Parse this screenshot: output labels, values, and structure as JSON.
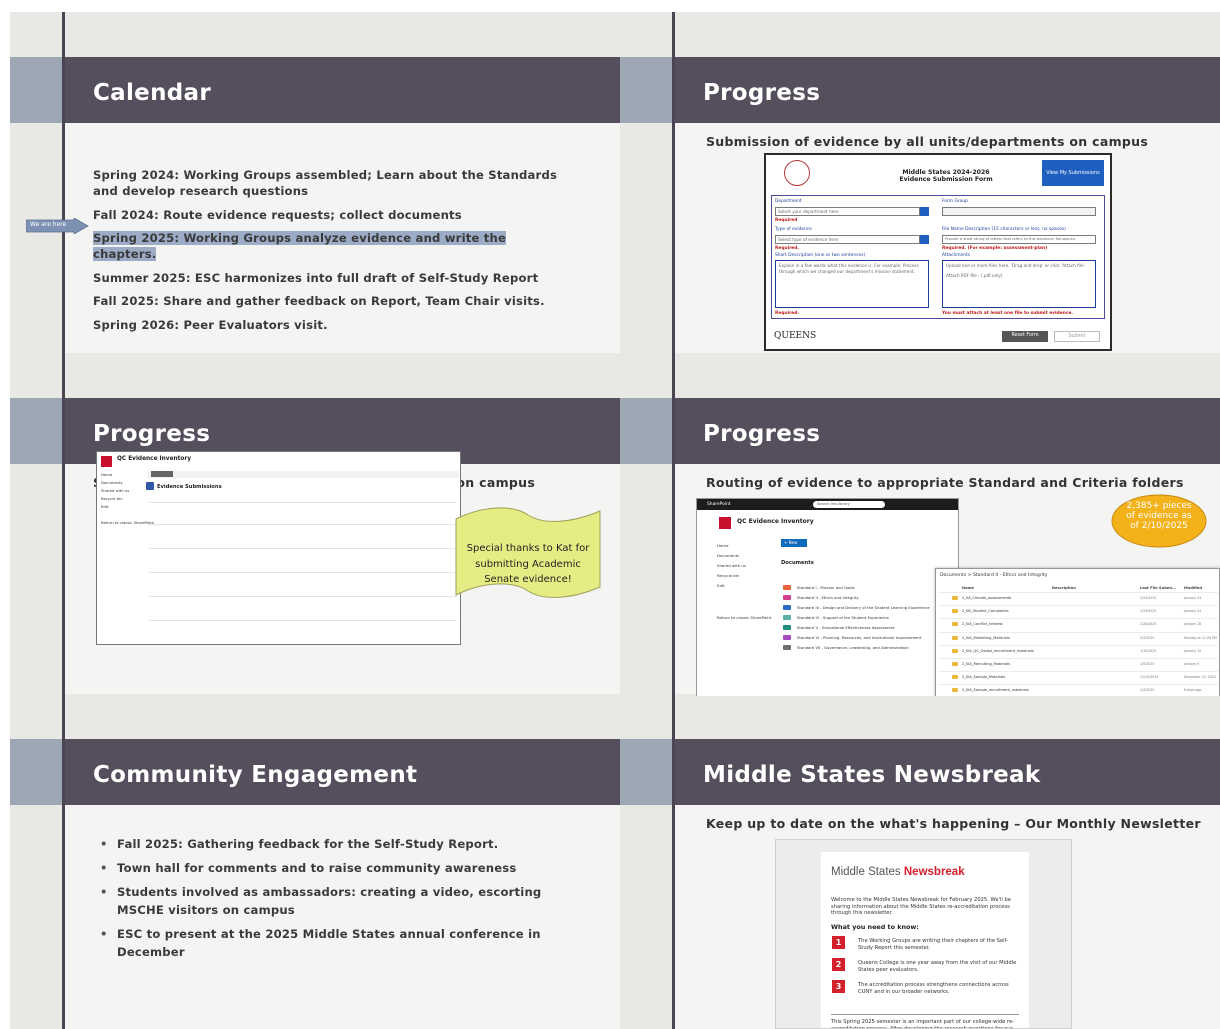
{
  "slides": {
    "calendar": {
      "title": "Calendar",
      "arrow_label": "We are here",
      "items": [
        "Spring 2024: Working Groups assembled; Learn about the Standards and develop research questions",
        "Fall 2024: Route evidence requests; collect documents",
        "Spring 2025: Working Groups analyze evidence and write the chapters.",
        "Summer 2025: ESC harmonizes into full draft of Self-Study Report",
        "Fall 2025: Share and gather feedback on Report, Team Chair visits.",
        "Spring 2026: Peer Evaluators visit."
      ]
    },
    "progress1": {
      "title": "Progress",
      "subtitle": "Submission of evidence by all units/departments on campus",
      "form": {
        "title_line1": "Middle States 2024-2026",
        "title_line2": "Evidence Submission Form",
        "view_button": "View My Submissions",
        "department_label": "Department",
        "department_placeholder": "Select your department here",
        "form_group_label": "Form Group",
        "required": "Required",
        "type_label": "Type of evidence",
        "type_placeholder": "Select type of evidence here",
        "required2": "Required.",
        "file_name_label": "File Name Description (15 characters or less, no spaces)",
        "file_name_placeholder": "Provide a short string of letters that refers to this evidence. No spaces.",
        "file_name_required": "Required. (For example: assessment-plan)",
        "short_desc_label": "Short Description (one or two sentences)",
        "short_desc_text": "Explain in a few words what this evidence is. For example: Process through which we changed our department's mission statement.",
        "attachments_label": "Attachments",
        "attachments_text": "Upload one or more files here. 'Drag and drop' or click 'Attach file'.",
        "attach_file": "Attach PDF file - (.pdf only)",
        "required3": "Required.",
        "attach_warning": "You must attach at least one file to submit evidence.",
        "footer_logo": "QUEENS",
        "reset_button": "Reset Form",
        "submit_button": "Submit"
      }
    },
    "progress2": {
      "title": "Progress",
      "subtitle": "Submission of evidence by all units/departments on campus",
      "library": {
        "site_name": "QC Evidence Inventory",
        "list_name": "Evidence Submissions",
        "nav": [
          "Home",
          "Documents",
          "Shared with us",
          "Recycle bin",
          "Edit",
          "Return to classic SharePoint"
        ]
      },
      "callout": "Special thanks to Kat for submitting Academic Senate evidence!"
    },
    "progress3": {
      "title": "Progress",
      "subtitle": "Routing of evidence to appropriate Standard and Criteria folders",
      "badge": "2,385+ pieces of evidence as of 2/10/2025",
      "sharepoint": {
        "app": "SharePoint",
        "search": "Search this library",
        "site_name": "QC Evidence Inventory",
        "nav": [
          "Home",
          "Documents",
          "Shared with us",
          "Recycle bin",
          "Edit",
          "Return to classic SharePoint"
        ],
        "new_button": "+ New",
        "docs_title": "Documents",
        "folders": [
          "Standard I - Mission and Goals",
          "Standard II - Ethics and Integrity",
          "Standard III - Design and Delivery of the Student Learning Experience",
          "Standard IV - Support of the Student Experience",
          "Standard V - Educational Effectiveness Assessment",
          "Standard VI - Planning, Resources, and Institutional Improvement",
          "Standard VII - Governance, Leadership, and Administration"
        ],
        "folder_colors": [
          "#e8613a",
          "#d43f8d",
          "#2b6cc4",
          "#5bb0a8",
          "#1c8f7c",
          "#a54bc4",
          "#6f6f6f"
        ]
      },
      "detail": {
        "breadcrumb": "Documents  >  Standard II - Ethics and Integrity",
        "headers": [
          "Name",
          "Description",
          "Last File Submi...",
          "Modified"
        ],
        "rows": [
          {
            "name": "2_IIA_Climate_assessments",
            "date": "1/24/2025",
            "mod": "January 24"
          },
          {
            "name": "2_IIB_Student_Complaints",
            "date": "1/24/2025",
            "mod": "January 24"
          },
          {
            "name": "2_IIIA_Conflict_Interest",
            "date": "1/28/2025",
            "mod": "January 28"
          },
          {
            "name": "2_IIIA_Marketing_Materials",
            "date": "2/3/2025",
            "mod": "Monday at 11:06 PM"
          },
          {
            "name": "2_IIIA_QC_Global_recruitment_materials",
            "date": "1/15/2025",
            "mod": "January 15"
          },
          {
            "name": "2_IIIA_Recruiting_Materials",
            "date": "1/9/2025",
            "mod": "January 9"
          },
          {
            "name": "2_IIIA_Sample_Materials",
            "date": "12/10/2024",
            "mod": "December 10, 2024"
          },
          {
            "name": "2_IIIA_Sample_recruitment_materials",
            "date": "2/4/2025",
            "mod": "6 days ago"
          },
          {
            "name": "2_IIIC_PCT_of_Overall_Budget",
            "date": "12/10/2024",
            "mod": "December 10, 2024"
          }
        ]
      }
    },
    "community": {
      "title": "Community Engagement",
      "bullets": [
        "Fall 2025: Gathering feedback for the Self-Study Report.",
        "Town hall for comments and to raise community awareness",
        "Students involved as ambassadors: creating a video, escorting MSCHE visitors on campus",
        "ESC to present at the 2025 Middle States annual conference in December"
      ]
    },
    "newsbreak": {
      "title": "Middle States Newsbreak",
      "subtitle": "Keep up to date on the what's happening – Our Monthly Newsletter",
      "newsletter": {
        "title_plain": "Middle States ",
        "title_red": "Newsbreak",
        "intro": "Welcome to the Middle States Newsbreak for February 2025. We'll be sharing information about the Middle States re-accreditation process through this newsletter.",
        "heading": "What you need to know:",
        "items": [
          {
            "num": "1",
            "text": "The Working Groups are writing their chapters of the Self-Study Report this semester."
          },
          {
            "num": "2",
            "text": "Queens College is one year away from the visit of our Middle States peer evaluators."
          },
          {
            "num": "3",
            "text": "The accreditation process strengthens connections across CUNY and in our broader networks."
          }
        ],
        "footer": "This Spring 2025 semester is an important part of our college-wide re-accreditation process. After developing the research questions for our Self-"
      }
    }
  }
}
